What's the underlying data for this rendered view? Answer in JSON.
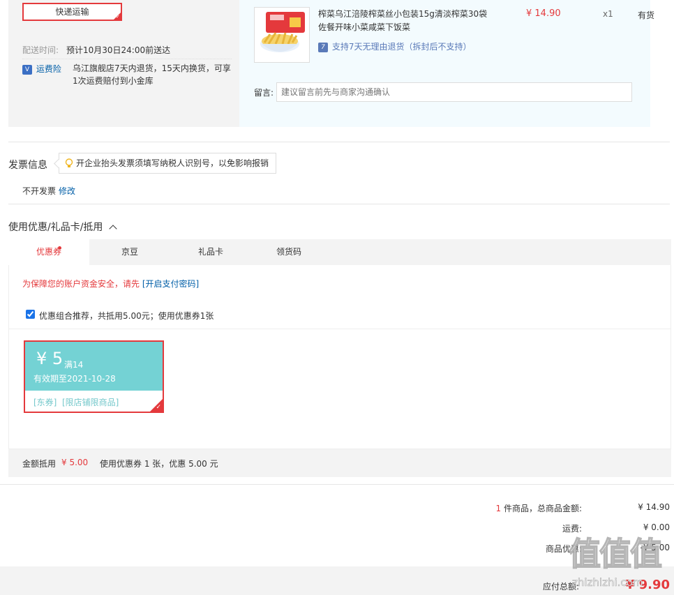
{
  "shipping": {
    "method_label": "快递运输",
    "time_label": "配送时间:",
    "time_value": "预计10月30日24:00前送达",
    "insurance_label": "运费险",
    "insurance_desc_1": "乌江旗舰店7天内退货，15天内换货，可享",
    "insurance_desc_2": "1次运费赔付到小金库"
  },
  "product": {
    "title_1": "榨菜乌江涪陵榨菜丝小包装15g清淡榨菜30袋",
    "title_2": "佐餐开味小菜咸菜下饭菜",
    "price": "¥ 14.90",
    "qty": "x1",
    "stock": "有货",
    "return_badge": "7",
    "return_text": "支持7天无理由退货（拆封后不支持）",
    "message_label": "留言:",
    "message_placeholder": "建议留言前先与商家沟通确认"
  },
  "invoice": {
    "title": "发票信息",
    "tip": "开企业抬头发票须填写纳税人识别号，以免影响报销",
    "status": "不开发票",
    "modify": "修改"
  },
  "discount": {
    "title": "使用优惠/礼品卡/抵用",
    "tabs": [
      "优惠券",
      "京豆",
      "礼品卡",
      "领货码"
    ],
    "security_text": "为保障您的账户资金安全，请先",
    "security_link": "[开启支付密码]",
    "combo_label": "优惠组合推荐，共抵用5.00元；使用优惠券1张",
    "coupon": {
      "amount": "¥ 5",
      "condition": "满14",
      "expiry": "有效期至2021-10-28",
      "tags": "[东券]  [限店铺限商品]"
    },
    "summary_label": "金额抵用",
    "summary_amount": "¥ 5.00",
    "summary_text": "使用优惠券 1 张，优惠 5.00 元"
  },
  "totals": {
    "count": "1",
    "goods_label": "件商品，总商品金额:",
    "goods_amount": "¥ 14.90",
    "freight_label": "运费:",
    "freight_amount": "¥ 0.00",
    "discount_label": "商品优惠:",
    "discount_amount": "-¥ 5.00",
    "payable_label": "应付总额:",
    "payable_amount": "¥ 9.90"
  },
  "watermark": "值值值",
  "watermark_url": "zhizhizhi.com",
  "colors": {
    "accent": "#e4393c",
    "coupon": "#74d2d4",
    "link": "#005ea7"
  }
}
